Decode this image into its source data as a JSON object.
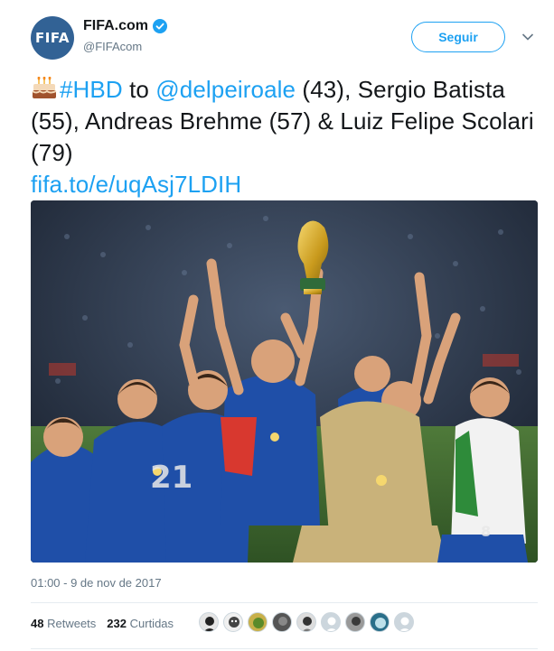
{
  "author": {
    "avatar_text": "FIFA",
    "display_name": "FIFA.com",
    "handle": "@FIFAcom",
    "verified": true
  },
  "follow_button_label": "Seguir",
  "tweet": {
    "emoji": "birthday-cake",
    "hashtag": "#HBD",
    "text_1": " to ",
    "mention": "@delpeiroale",
    "text_2": " (43), Sergio Batista (55), Andreas Brehme (57) & Luiz Felipe Scolari (79)",
    "link": "fifa.to/e/uqAsj7LDIH"
  },
  "photo_label": "Players celebrating with World Cup trophy",
  "timestamp": "01:00 - 9 de nov de 2017",
  "stats": {
    "retweets_count": "48",
    "retweets_label": "Retweets",
    "likes_count": "232",
    "likes_label": "Curtidas"
  },
  "colors": {
    "accent": "#1da1f2",
    "avatar_bg": "#326295",
    "secondary_text": "#657786"
  }
}
